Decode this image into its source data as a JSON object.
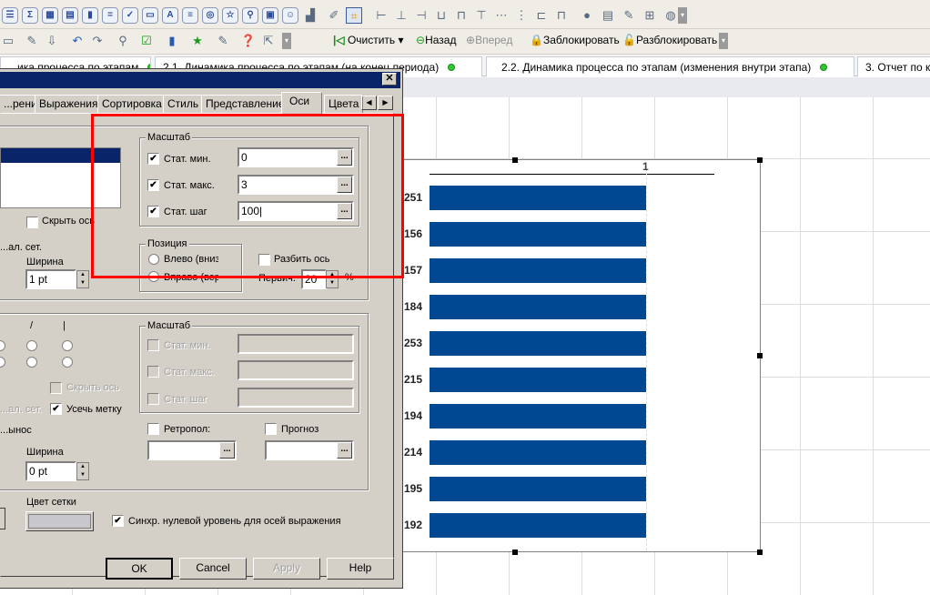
{
  "toolbar_row1": {
    "icons": [
      "list-box-icon",
      "sum-icon",
      "table-icon",
      "multibox-icon",
      "chart-icon",
      "input-icon",
      "check-icon",
      "button-icon",
      "text-icon",
      "line-arrow-icon",
      "slider-icon",
      "bookmark-icon",
      "search-object-icon",
      "container-icon",
      "custom-object-icon",
      "chart-wizard-icon",
      "format-painter-icon",
      "design-grid-icon",
      "align-left-icon",
      "align-center-icon",
      "align-right-icon",
      "align-bottom-icon",
      "align-middle-icon",
      "align-top-icon",
      "space-horizontal-icon",
      "space-vertical-icon",
      "adjust-left-icon",
      "adjust-top-icon",
      "user-icon",
      "sheet-properties-icon",
      "edit-icon",
      "tree-icon",
      "document-web-icon"
    ]
  },
  "toolbar_row2": {
    "clear": "Очистить",
    "back": "Назад",
    "forward": "Вперед",
    "lock": "Заблокировать",
    "unlock": "Разблокировать"
  },
  "sheet_tabs": [
    {
      "label": "...ика процесса по этапам",
      "active": false
    },
    {
      "label": "2.1. Динамика процесса по этапам   (на конец периода)",
      "active": false
    },
    {
      "label": "2.2. Динамика процесса по этапам   (изменения внутри этапа)",
      "active": false
    },
    {
      "label": "3. Отчет по к",
      "active": false
    }
  ],
  "dialog": {
    "tabs": [
      "...рения",
      "Выражения",
      "Сортировка",
      "Стиль",
      "Представление",
      "Оси",
      "Цвета"
    ],
    "active_tab": "Оси",
    "upper": {
      "hide_axis": "Скрыть ось",
      "minor_grid": "...ал. сет.",
      "width_label": "Ширина",
      "width_value": "1 pt",
      "scale": {
        "title": "Масштаб",
        "static_min": {
          "label": "Стат. мин.",
          "checked": true,
          "value": "0"
        },
        "static_max": {
          "label": "Стат. макс.",
          "checked": true,
          "value": "3"
        },
        "static_step": {
          "label": "Стат. шаг",
          "checked": true,
          "value": "100"
        }
      },
      "position": {
        "title": "Позиция",
        "left": "Влево (вниз",
        "right": "Вправо (верш"
      },
      "split_axis": "Разбить ось",
      "primary_label": "Первич.",
      "primary_value": "20",
      "percent": "%"
    },
    "lower": {
      "slash": "/",
      "pipe": "|",
      "hide_axis": "Скрыть ось",
      "minor_grid": "...ал. сет.",
      "truncate_label": "Усечь метку",
      "wrap": "...ынос",
      "width_label": "Ширина",
      "width_value": "0 pt",
      "scale": {
        "title": "Масштаб",
        "static_min": "Стат. мин.",
        "static_max": "Стат. макс.",
        "static_step": "Стат. шаг"
      },
      "backward": "Ретропол:",
      "forecast": "Прогноз"
    },
    "grid_color_label": "Цвет сетки",
    "sync_zero": "Синхр. нулевой уровень для осей выражения",
    "buttons": {
      "ok": "OK",
      "cancel": "Cancel",
      "apply": "Apply",
      "help": "Help"
    }
  },
  "chart": {
    "axis_tick": "1",
    "categories": [
      "251",
      "156",
      "157",
      "184",
      "253",
      "215",
      "194",
      "214",
      "195",
      "192"
    ],
    "values": [
      1,
      1,
      1,
      1,
      1,
      1,
      1,
      1,
      1,
      1
    ],
    "bar_color": "#004892"
  },
  "colors": {
    "highlight": "#ff0000",
    "title_bar": "#0a246a"
  }
}
